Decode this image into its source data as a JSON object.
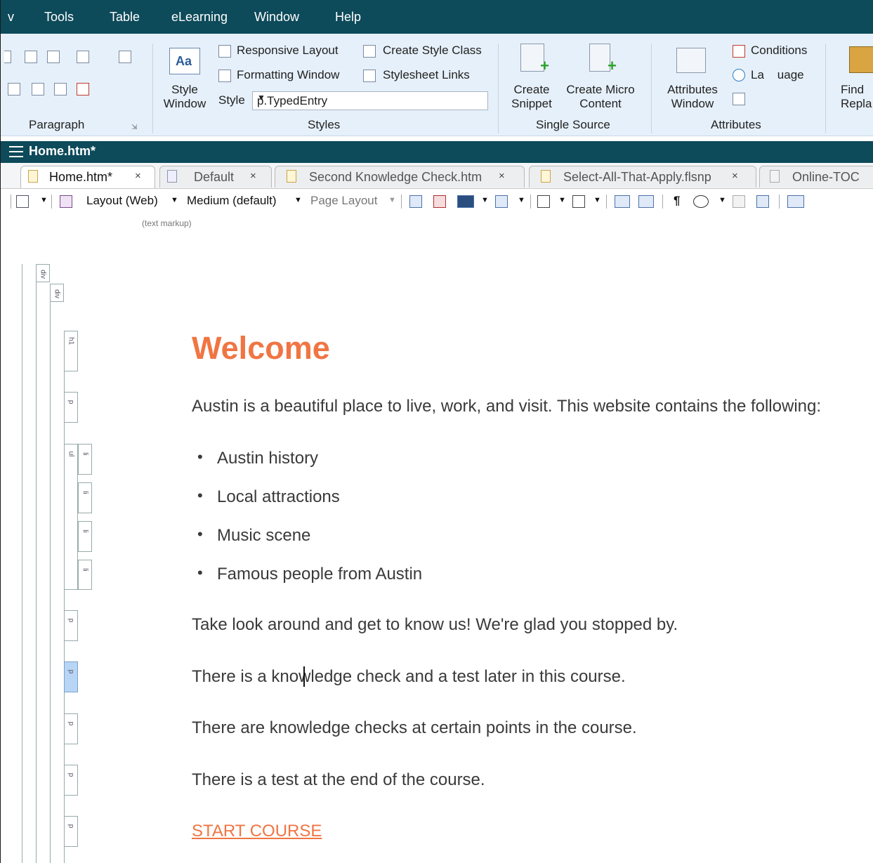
{
  "menu": {
    "items": [
      "v",
      "Tools",
      "Table",
      "eLearning",
      "Window",
      "Help"
    ]
  },
  "ribbon": {
    "paragraph_group": "Paragraph",
    "styles_group": {
      "label": "Styles",
      "style_window": [
        "Style",
        "Window"
      ],
      "responsive_layout": "Responsive Layout",
      "formatting_window": "Formatting Window",
      "create_style_class": "Create Style Class",
      "stylesheet_links": "Stylesheet Links",
      "style_label": "Style",
      "style_value": "p.TypedEntry"
    },
    "single_source_group": {
      "label": "Single Source",
      "create_snippet": [
        "Create",
        "Snippet"
      ],
      "create_micro_content": [
        "Create Micro",
        "Content"
      ]
    },
    "attributes_group": {
      "label": "Attributes",
      "attributes_window": [
        "Attributes",
        "Window"
      ],
      "conditions": "Conditions",
      "language": "La    uage"
    },
    "find_replace": [
      "Find",
      "Repla"
    ]
  },
  "document": {
    "title": "Home.htm*"
  },
  "tabs": [
    {
      "label": "Home.htm*",
      "close": "×"
    },
    {
      "label": "Default",
      "close": "×"
    },
    {
      "label": "Second Knowledge Check.htm",
      "close": "×"
    },
    {
      "label": "Select-All-That-Apply.flsnp",
      "close": "×"
    },
    {
      "label": "Online-TOC",
      "close": ""
    }
  ],
  "editor_toolbar": {
    "layout": "Layout (Web)",
    "medium": "Medium (default)",
    "page_layout": "Page Layout",
    "markup_label": "(text markup)",
    "glyph_para": "¶"
  },
  "structure_tags": {
    "div": "div",
    "h1": "h1",
    "p": "p",
    "ul": "ul",
    "li": "li"
  },
  "content": {
    "heading": "Welcome",
    "intro": "Austin is a beautiful place to live, work, and visit. This website contains the following:",
    "bullets": [
      "Austin history",
      "Local attractions",
      "Music scene",
      "Famous people from Austin"
    ],
    "p1": "Take look around and get to know us! We're glad you stopped by.",
    "p2": "There is a knowledge check and a test later in this course.",
    "p3": "There are knowledge checks at certain points in the course.",
    "p4": "There is a test at the end of the course.",
    "link": "START COURSE"
  },
  "colors": {
    "menubar": "#0d4a5a",
    "ribbon": "#e6f0fa",
    "accent": "#f07542",
    "pointer": "#e8542a"
  }
}
